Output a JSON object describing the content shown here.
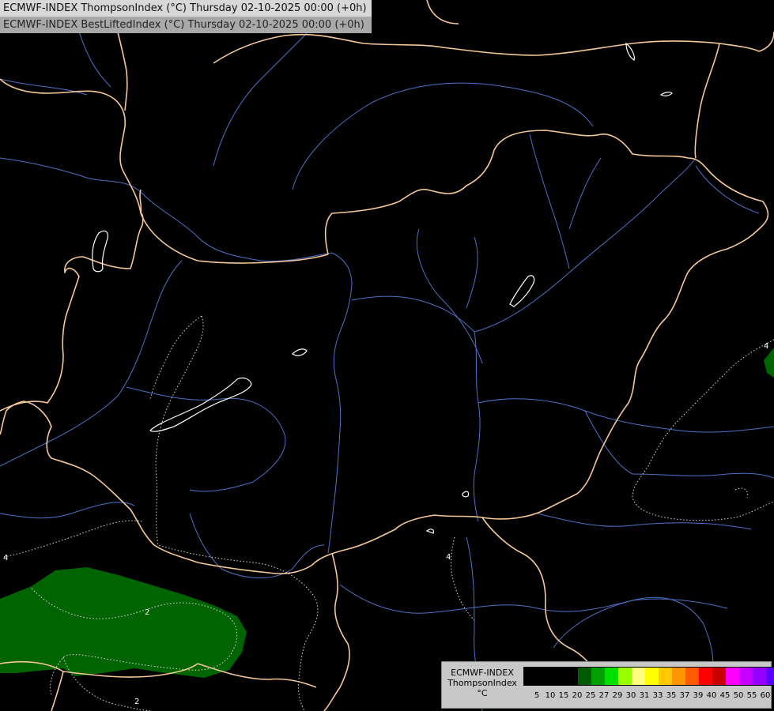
{
  "titles": {
    "line1": "ECMWF-INDEX ThompsonIndex (°C) Thursday 02-10-2025 00:00 (+0h)",
    "line2": "ECMWF-INDEX BestLiftedIndex (°C) Thursday 02-10-2025 00:00 (+0h)"
  },
  "legend": {
    "title_lines": [
      "ECMWF-INDEX",
      "ThompsonIndex",
      "°C"
    ],
    "colors": [
      "#000000",
      "#000000",
      "#000000",
      "#000000",
      "#005a00",
      "#00a000",
      "#00e000",
      "#9cff00",
      "#ffff80",
      "#ffff00",
      "#ffc800",
      "#ff9600",
      "#ff5a00",
      "#ff0000",
      "#c80000",
      "#ff00ff",
      "#c800ff",
      "#9600ff",
      "#5a00ff",
      "#0000ff"
    ],
    "ticks": [
      "5",
      "10",
      "15",
      "20",
      "25",
      "27",
      "29",
      "30",
      "31",
      "33",
      "35",
      "37",
      "39",
      "40",
      "45",
      "50",
      "55",
      "60"
    ]
  },
  "contour_labels": [
    "4",
    "4",
    "4",
    "2",
    "2"
  ],
  "colors": {
    "background": "#000000",
    "border": "#f5c898",
    "river": "#4d72c8",
    "lake_outline": "#ffffff",
    "contour": "#dddddd",
    "green_fill": "#006400"
  }
}
